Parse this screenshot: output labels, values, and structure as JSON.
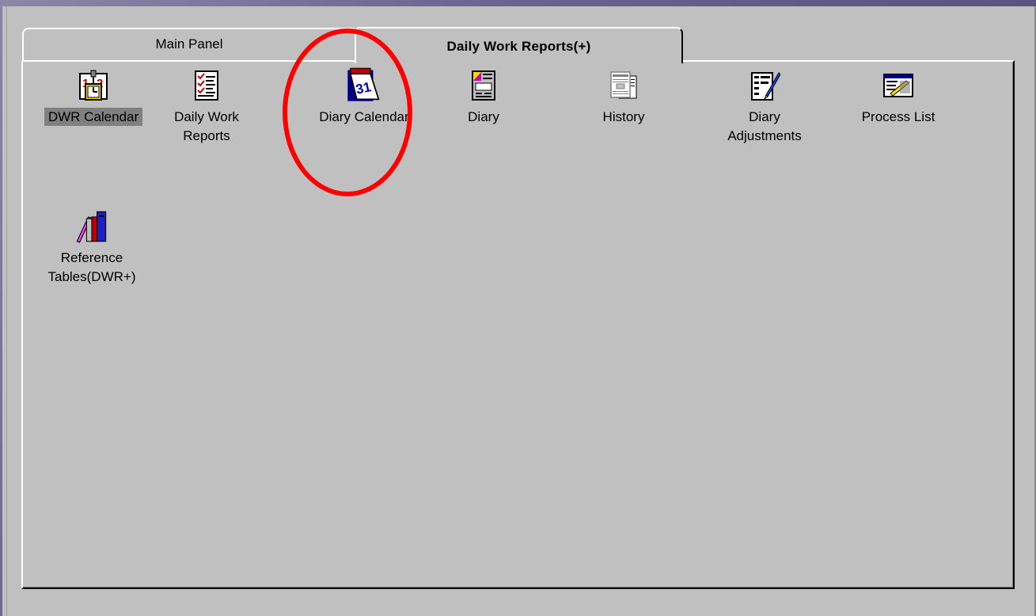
{
  "tabs": [
    {
      "label": "Main Panel",
      "active": false
    },
    {
      "label": "Daily Work Reports(+)",
      "active": true
    }
  ],
  "items": [
    {
      "label_line1": "DWR Calendar",
      "label_line2": "",
      "icon": "dwr-calendar-icon",
      "selected": true
    },
    {
      "label_line1": "Daily Work",
      "label_line2": "Reports",
      "icon": "checklist-icon",
      "selected": false
    },
    {
      "label_line1": "Diary Calendar",
      "label_line2": "",
      "icon": "tear-off-calendar-icon",
      "selected": false
    },
    {
      "label_line1": "Diary",
      "label_line2": "",
      "icon": "diary-form-icon",
      "selected": false
    },
    {
      "label_line1": "History",
      "label_line2": "",
      "icon": "documents-icon",
      "selected": false
    },
    {
      "label_line1": "Diary",
      "label_line2": "Adjustments",
      "icon": "edit-pen-icon",
      "selected": false
    },
    {
      "label_line1": "Process List",
      "label_line2": "",
      "icon": "window-list-icon",
      "selected": false
    },
    {
      "label_line1": "Reference",
      "label_line2": "Tables(DWR+)",
      "icon": "books-icon",
      "selected": false
    }
  ],
  "annotation": {
    "shape": "circle",
    "color": "#ff0000",
    "target": "Diary Calendar"
  },
  "colors": {
    "background": "#c0c0c0",
    "selection": "#808080",
    "annotation": "#ff0000"
  }
}
